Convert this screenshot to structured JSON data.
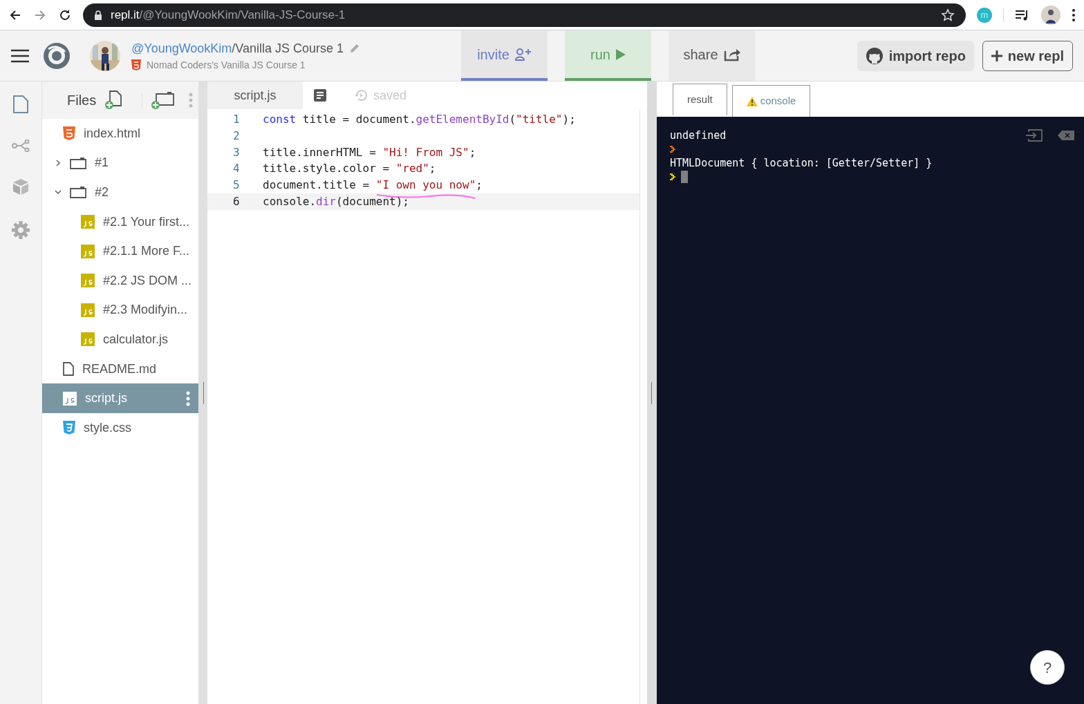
{
  "browser": {
    "url_host": "repl.it",
    "url_path": "/@YoungWookKim/Vanilla-JS-Course-1",
    "extension_letter": "m"
  },
  "header": {
    "owner": "@YoungWookKim",
    "repl_name": "/Vanilla JS Course 1",
    "description": "Nomad Coders's Vanilla JS Course 1",
    "actions": [
      {
        "kind": "invite",
        "label": "invite"
      },
      {
        "kind": "run",
        "label": "run"
      },
      {
        "kind": "share",
        "label": "share"
      }
    ],
    "import_label": "import repo",
    "new_label": "new repl"
  },
  "files": {
    "title": "Files",
    "tree": [
      {
        "kind": "html",
        "name": "index.html",
        "selected": false
      },
      {
        "kind": "folder",
        "name": "#1",
        "expanded": false,
        "selected": false
      },
      {
        "kind": "folder",
        "name": "#2",
        "expanded": true,
        "selected": false,
        "children": [
          {
            "kind": "js",
            "name": "#2.1 Your first...",
            "selected": false
          },
          {
            "kind": "js",
            "name": "#2.1.1 More F...",
            "selected": false
          },
          {
            "kind": "js",
            "name": "#2.2 JS DOM ...",
            "selected": false
          },
          {
            "kind": "js",
            "name": "#2.3 Modifyin...",
            "selected": false
          },
          {
            "kind": "js",
            "name": "calculator.js",
            "selected": false
          }
        ]
      },
      {
        "kind": "md",
        "name": "README.md",
        "selected": false
      },
      {
        "kind": "js",
        "name": "script.js",
        "selected": true
      },
      {
        "kind": "css",
        "name": "style.css",
        "selected": false
      }
    ]
  },
  "editor": {
    "file_tab": "script.js",
    "status": "saved",
    "lines": [
      {
        "number": "1",
        "selected": false,
        "tokens": [
          {
            "kind": "keyword",
            "text": "const"
          },
          {
            "kind": "plain",
            "text": " title = document."
          },
          {
            "kind": "method",
            "text": "getElementById"
          },
          {
            "kind": "plain",
            "text": "("
          },
          {
            "kind": "string",
            "text": "\"title\""
          },
          {
            "kind": "plain",
            "text": ");"
          }
        ]
      },
      {
        "number": "2",
        "selected": false
      },
      {
        "number": "3",
        "selected": false,
        "tokens": [
          {
            "kind": "plain",
            "text": "title.innerHTML = "
          },
          {
            "kind": "string",
            "text": "\"Hi! From JS\""
          },
          {
            "kind": "plain",
            "text": ";"
          }
        ]
      },
      {
        "number": "4",
        "selected": false,
        "tokens": [
          {
            "kind": "plain",
            "text": "title.style.color = "
          },
          {
            "kind": "string",
            "text": "\"red\""
          },
          {
            "kind": "plain",
            "text": ";"
          }
        ]
      },
      {
        "number": "5",
        "selected": false,
        "tokens": [
          {
            "kind": "plain",
            "text": "document.title = "
          },
          {
            "kind": "string",
            "text": "\"I own you now\"",
            "underlined": true
          },
          {
            "kind": "plain",
            "text": ";"
          }
        ]
      },
      {
        "number": "6",
        "selected": true,
        "tokens": [
          {
            "kind": "plain",
            "text": "console."
          },
          {
            "kind": "method",
            "text": "dir"
          },
          {
            "kind": "plain",
            "text": "(document);"
          }
        ]
      }
    ]
  },
  "output": {
    "tabs": [
      {
        "label": "result",
        "selected": false,
        "warning": false
      },
      {
        "label": "console",
        "selected": true,
        "warning": true
      }
    ],
    "lines": [
      {
        "kind": "text",
        "text": "undefined"
      },
      {
        "kind": "prompt",
        "color": "#e06c00",
        "cursor": false
      },
      {
        "kind": "text",
        "text": "HTMLDocument { location: [Getter/Setter] }"
      },
      {
        "kind": "prompt",
        "color": "#e8c400",
        "cursor": true
      }
    ],
    "help_label": "?"
  }
}
